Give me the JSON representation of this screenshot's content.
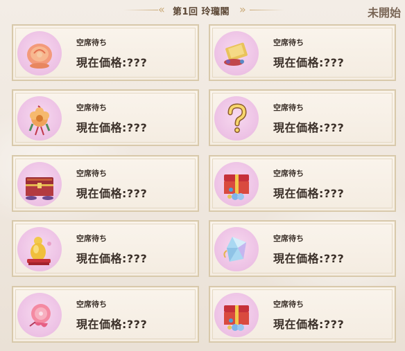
{
  "header": {
    "title": "第1回 玲瓏閣",
    "status": "未開始"
  },
  "items": [
    {
      "slot_text": "空席待ち",
      "price_text": "現在価格:???",
      "icon": "peach-bun-icon"
    },
    {
      "slot_text": "空席待ち",
      "price_text": "現在価格:???",
      "icon": "golden-scroll-icon"
    },
    {
      "slot_text": "空席待ち",
      "price_text": "現在価格:???",
      "icon": "flower-charm-icon"
    },
    {
      "slot_text": "空席待ち",
      "price_text": "現在価格:???",
      "icon": "question-mark-icon"
    },
    {
      "slot_text": "空席待ち",
      "price_text": "現在価格:???",
      "icon": "treasure-chest-icon"
    },
    {
      "slot_text": "空席待ち",
      "price_text": "現在価格:???",
      "icon": "red-gift-box-icon"
    },
    {
      "slot_text": "空席待ち",
      "price_text": "現在価格:???",
      "icon": "golden-gourd-icon"
    },
    {
      "slot_text": "空席待ち",
      "price_text": "現在価格:???",
      "icon": "crystal-gem-icon"
    },
    {
      "slot_text": "空席待ち",
      "price_text": "現在価格:???",
      "icon": "peach-blossom-icon"
    },
    {
      "slot_text": "空席待ち",
      "price_text": "現在価格:???",
      "icon": "red-gift-box-icon"
    }
  ],
  "colors": {
    "card_border": "#d8c9ab",
    "icon_bg": "#eec4e6",
    "text": "#3a2f28"
  }
}
